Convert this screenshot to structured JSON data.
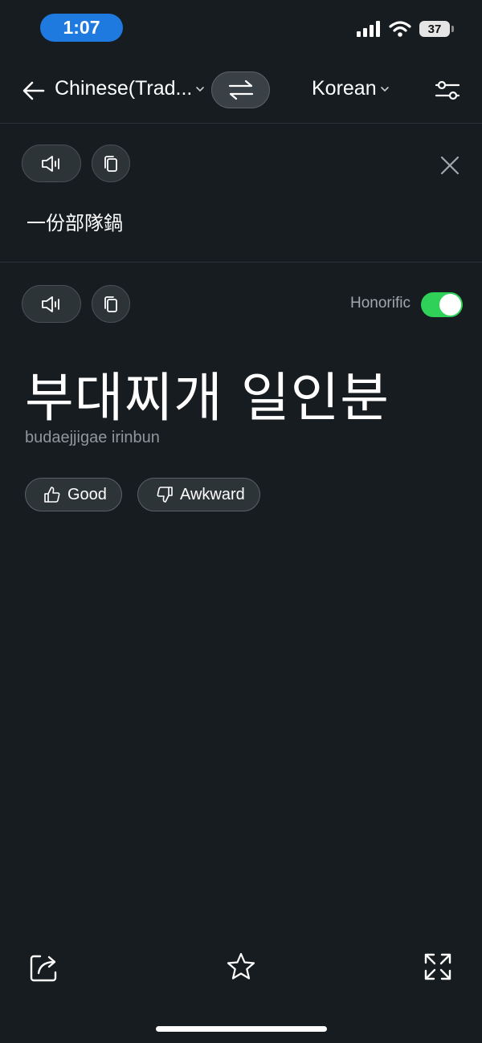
{
  "status_bar": {
    "time": "1:07",
    "battery": "37",
    "icons": [
      "cellular-signal-icon",
      "wifi-icon",
      "battery-icon"
    ]
  },
  "header": {
    "source_language": "Chinese(Trad...",
    "target_language": "Korean",
    "icons": [
      "back-arrow-icon",
      "chevron-down-icon",
      "swap-icon",
      "settings-sliders-icon"
    ]
  },
  "source": {
    "text": "一份部隊鍋",
    "icons": [
      "speaker-icon",
      "copy-icon",
      "close-icon"
    ]
  },
  "result": {
    "honorific_label": "Honorific",
    "honorific_on": true,
    "translation": "부대찌개 일인분",
    "romanization": "budaejjigae irinbun",
    "good_label": "Good",
    "awkward_label": "Awkward",
    "icons": [
      "speaker-icon",
      "copy-icon",
      "thumbs-up-icon",
      "thumbs-down-icon"
    ]
  },
  "bottom_bar": {
    "icons": [
      "share-icon",
      "star-icon",
      "expand-icon"
    ]
  },
  "colors": {
    "background": "#161c20",
    "accent": "#1f7ae0",
    "toggle_on": "#30d158",
    "button_bg": "#2d3438",
    "muted_text": "#8f979c"
  }
}
